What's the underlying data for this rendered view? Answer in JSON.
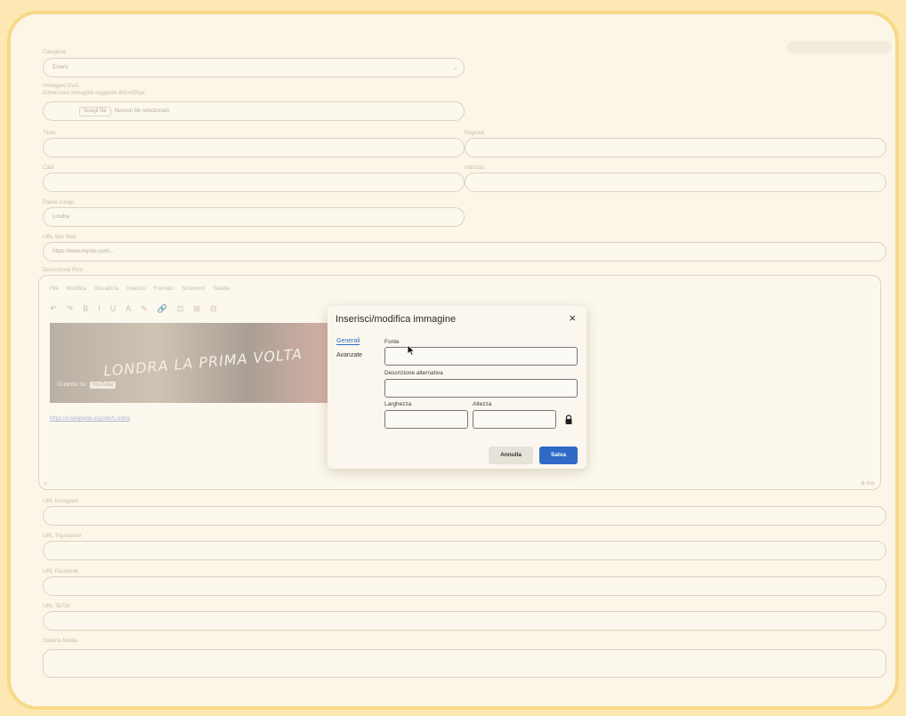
{
  "form": {
    "category_label": "Categoria",
    "category_value": "Estero",
    "image_label": "Immagine Evid.",
    "image_hint": "Dimensioni immagine suggerite 800x450px",
    "file_button": "Scegli file",
    "file_status": "Nessun file selezionato",
    "title_label": "Titolo",
    "region_label": "Regione",
    "city_label": "Città",
    "address_label": "Indirizzo",
    "place_label": "Paese Luogo",
    "place_value": "Londra",
    "url_label": "URL Sito Web",
    "url_value": "https://www.mysite.com/...",
    "description_label": "Descrizione Post",
    "instagram_label": "URL Instagram",
    "tripadvisor_label": "URL TripAdvisor",
    "facebook_label": "URL Facebook",
    "tiktok_label": "URL TikTok",
    "gallery_label": "Galleria Media"
  },
  "editor": {
    "menu": [
      "File",
      "Modifica",
      "Visualizza",
      "Inserisci",
      "Formato",
      "Strumenti",
      "Tabella"
    ],
    "toolbar": [
      "↶",
      "↷",
      "B",
      "I",
      "U",
      "A",
      "✎",
      "🔗",
      "⊡",
      "⊞",
      "⊟"
    ],
    "video_title": "LONDRA LA PRIMA VOLTA",
    "video_watch": "Guarda su",
    "video_brand": "YouTube",
    "video_link": "https://it.wikipedia.org/wiki/Londra",
    "footer_left": "p",
    "footer_right": "⊕ tiny"
  },
  "dialog": {
    "title": "Inserisci/modifica immagine",
    "close": "×",
    "tab_general": "Generali",
    "tab_advanced": "Avanzate",
    "source_label": "Fonte",
    "alt_label": "Descrizione alternativa",
    "width_label": "Larghezza",
    "height_label": "Altezza",
    "cancel_label": "Annulla",
    "save_label": "Salva"
  },
  "colors": {
    "accent": "#2f6bc6",
    "frame_border": "#f8d889",
    "outer_background": "#fde8b4"
  },
  "icons": [
    "chevron-down-icon",
    "undo-icon",
    "redo-icon",
    "bold-icon",
    "italic-icon",
    "underline-icon",
    "text-color-icon",
    "highlight-icon",
    "link-icon",
    "image-icon",
    "media-icon",
    "close-icon",
    "lock-icon",
    "mouse-cursor-icon"
  ]
}
